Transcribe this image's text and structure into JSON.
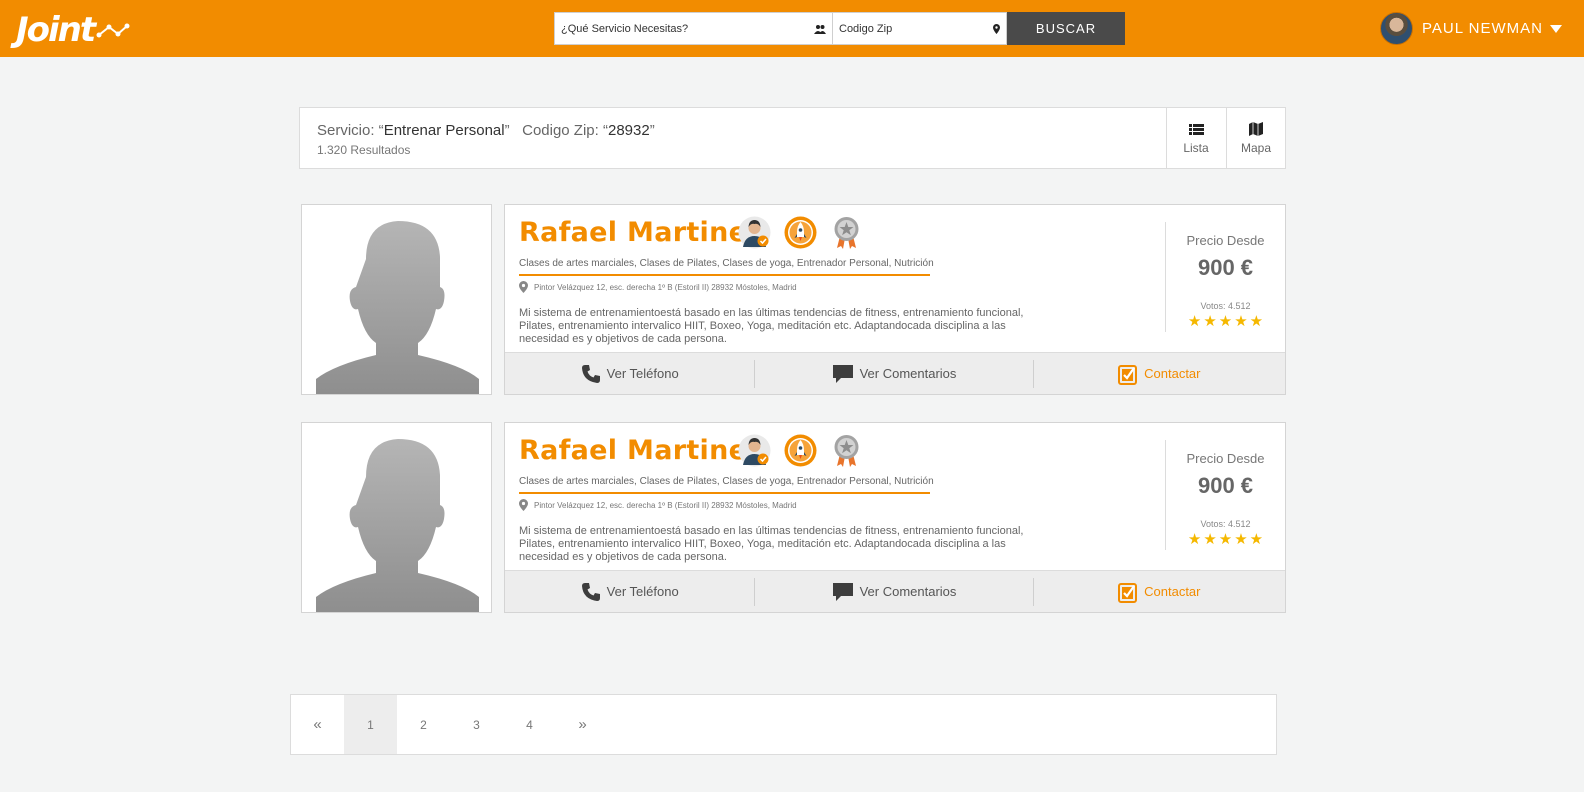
{
  "header": {
    "logo_text": "Joint",
    "search": {
      "service_placeholder": "¿Qué Servicio Necesitas?",
      "zip_placeholder": "Codigo Zip",
      "button_label": "Buscar"
    },
    "user": {
      "name": "PAUL NEWMAN"
    }
  },
  "summary": {
    "service_prefix": "Servicio: “",
    "service_value": "Entrenar Personal",
    "service_suffix": "”",
    "zip_prefix": "Codigo Zip: “",
    "zip_value": "28932",
    "zip_suffix": "”",
    "results": "1.320 Resultados",
    "views": [
      {
        "label": "Lista",
        "icon": "list-icon"
      },
      {
        "label": "Mapa",
        "icon": "map-icon"
      }
    ]
  },
  "results": [
    {
      "name": "Rafael Martinez",
      "badges": [
        "verified-user-badge",
        "rocket-badge",
        "award-medal-badge"
      ],
      "categories": "Clases de artes marciales, Clases de Pilates, Clases de yoga, Entrenador Personal, Nutrición",
      "address": "Pintor Velázquez 12, esc. derecha 1º B (Estoril II) 28932 Móstoles, Madrid",
      "description": "Mi sistema de entrenamientoestá basado en las últimas tendencias de fitness, entrenamiento funcional, Pilates, entrenamiento intervalico HIIT, Boxeo, Yoga, meditación etc. Adaptandocada disciplina a las necesidad es y objetivos de cada persona.",
      "price_label": "Precio Desde",
      "price": "900 €",
      "votes": "Votos: 4.512",
      "rating": 5,
      "actions": {
        "phone": "Ver Teléfono",
        "comments": "Ver Comentarios",
        "contact": "Contactar"
      }
    },
    {
      "name": "Rafael Martinez",
      "badges": [
        "verified-user-badge",
        "rocket-badge",
        "award-medal-badge"
      ],
      "categories": "Clases de artes marciales, Clases de Pilates, Clases de yoga, Entrenador Personal, Nutrición",
      "address": "Pintor Velázquez 12, esc. derecha 1º B (Estoril II) 28932 Móstoles, Madrid",
      "description": "Mi sistema de entrenamientoestá basado en las últimas tendencias de fitness, entrenamiento funcional, Pilates, entrenamiento intervalico HIIT, Boxeo, Yoga, meditación etc. Adaptandocada disciplina a las necesidad es y objetivos de cada persona.",
      "price_label": "Precio Desde",
      "price": "900 €",
      "votes": "Votos: 4.512",
      "rating": 5,
      "actions": {
        "phone": "Ver Teléfono",
        "comments": "Ver Comentarios",
        "contact": "Contactar"
      }
    }
  ],
  "pagination": {
    "prev": "«",
    "pages": [
      "1",
      "2",
      "3",
      "4"
    ],
    "active": "1",
    "next": "»"
  },
  "colors": {
    "brand": "#f28c00",
    "dark_button": "#4a4a4a",
    "star": "#f5b800"
  }
}
